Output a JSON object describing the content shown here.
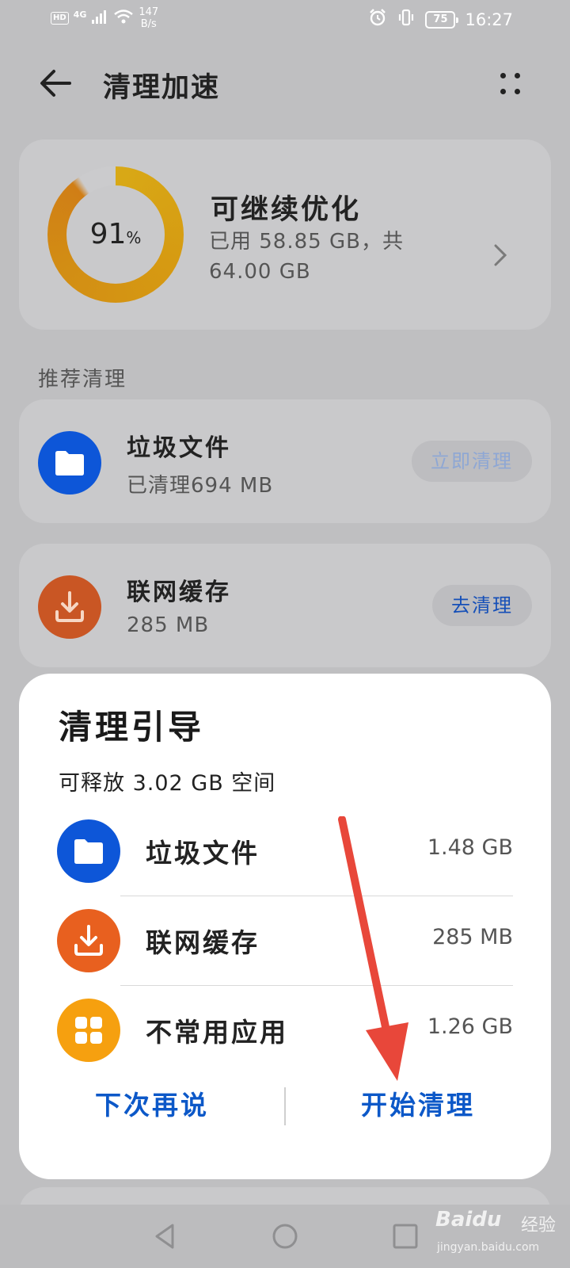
{
  "status_bar": {
    "hd": "HD",
    "network": "4G",
    "speed_value": "147",
    "speed_unit": "B/s",
    "battery": "75",
    "time": "16:27"
  },
  "header": {
    "title": "清理加速"
  },
  "storage": {
    "percent": "91",
    "percent_sign": "%",
    "percent_value": 91,
    "title": "可继续优化",
    "detail": "已用 58.85 GB，共 64.00 GB"
  },
  "recommend": {
    "label": "推荐清理",
    "items": [
      {
        "name": "垃圾文件",
        "sub": "已清理694 MB",
        "button": "立即清理",
        "button_state": "disabled",
        "icon": "folder-icon",
        "color": "#0d56d8"
      },
      {
        "name": "联网缓存",
        "sub": "285 MB",
        "button": "去清理",
        "button_state": "active",
        "icon": "download-icon",
        "color": "#e8601f"
      }
    ]
  },
  "dialog": {
    "title": "清理引导",
    "subtitle": "可释放 3.02 GB 空间",
    "rows": [
      {
        "name": "垃圾文件",
        "size": "1.48 GB",
        "icon": "folder-icon",
        "color": "#0d56d8"
      },
      {
        "name": "联网缓存",
        "size": "285 MB",
        "icon": "download-icon",
        "color": "#e8601f"
      },
      {
        "name": "不常用应用",
        "size": "1.26 GB",
        "icon": "apps-grid-icon",
        "color": "#f6a00f"
      }
    ],
    "cancel": "下次再说",
    "confirm": "开始清理"
  },
  "watermark": {
    "brand": "Baidu",
    "brand_cn": "经验",
    "url": "jingyan.baidu.com"
  },
  "colors": {
    "accent": "#0c58c8",
    "annotation_arrow": "#e8473a"
  }
}
